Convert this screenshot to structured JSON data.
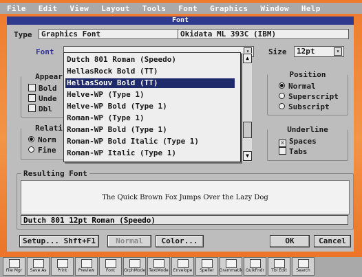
{
  "menubar": [
    "File",
    "Edit",
    "View",
    "Layout",
    "Tools",
    "Font",
    "Graphics",
    "Window",
    "Help"
  ],
  "dialog": {
    "title": "Font",
    "type_label": "Type",
    "type_value": "Graphics Font",
    "printer": "Okidata ML 393C (IBM)",
    "font_label": "Font",
    "font_value": "_",
    "size_label": "Size",
    "size_value": "12pt",
    "appearance": {
      "title": "Appear",
      "items": [
        {
          "label": "Bold",
          "checked": false
        },
        {
          "label": "Unde",
          "checked": false
        },
        {
          "label": "Dbl",
          "checked": false
        }
      ]
    },
    "relative": {
      "title": "Relati",
      "items": [
        {
          "label": "Norm",
          "selected": true
        },
        {
          "label": "Fine",
          "selected": false
        }
      ]
    },
    "position": {
      "title": "Position",
      "items": [
        {
          "label": "Normal",
          "selected": true
        },
        {
          "label": "Superscript",
          "selected": false
        },
        {
          "label": "Subscript",
          "selected": false
        }
      ]
    },
    "underline": {
      "title": "Underline",
      "items": [
        {
          "label": "Spaces",
          "checked": true
        },
        {
          "label": "Tabs",
          "checked": false
        }
      ]
    },
    "dropdown_items": [
      "Dutch 801 Roman (Speedo)",
      "HellasRock Bold (TT)",
      "HellasSouv Bold (TT)",
      "Helve-WP (Type 1)",
      "Helve-WP Bold (Type 1)",
      "Roman-WP (Type 1)",
      "Roman-WP Bold (Type 1)",
      "Roman-WP Bold Italic (Type 1)",
      "Roman-WP Italic (Type 1)"
    ],
    "selected_index": 2,
    "resulting_title": "Resulting Font",
    "preview_text": "The Quick Brown Fox Jumps Over the Lazy Dog",
    "resulting_font": "Dutch 801 12pt Roman (Speedo)",
    "buttons": {
      "setup": "Setup... Shft+F1",
      "normal": "Normal",
      "color": "Color...",
      "ok": "OK",
      "cancel": "Cancel"
    }
  },
  "buttonbar": [
    {
      "label": "File Mgr",
      "icon": "folder-icon"
    },
    {
      "label": "Save As",
      "icon": "disk-icon"
    },
    {
      "label": "Print",
      "icon": "printer-icon"
    },
    {
      "label": "Preview",
      "icon": "preview-icon"
    },
    {
      "label": "Font",
      "icon": "font-icon"
    },
    {
      "label": "GrphMode",
      "icon": "graphics-mode-icon"
    },
    {
      "label": "TextMode",
      "icon": "text-mode-icon"
    },
    {
      "label": "Envelope",
      "icon": "envelope-icon"
    },
    {
      "label": "Speller",
      "icon": "speller-icon"
    },
    {
      "label": "Grammatik",
      "icon": "grammatik-icon"
    },
    {
      "label": "QuikFndr",
      "icon": "quickfinder-icon"
    },
    {
      "label": "Tbl Edit",
      "icon": "table-icon"
    },
    {
      "label": "Search",
      "icon": "search-icon"
    }
  ]
}
